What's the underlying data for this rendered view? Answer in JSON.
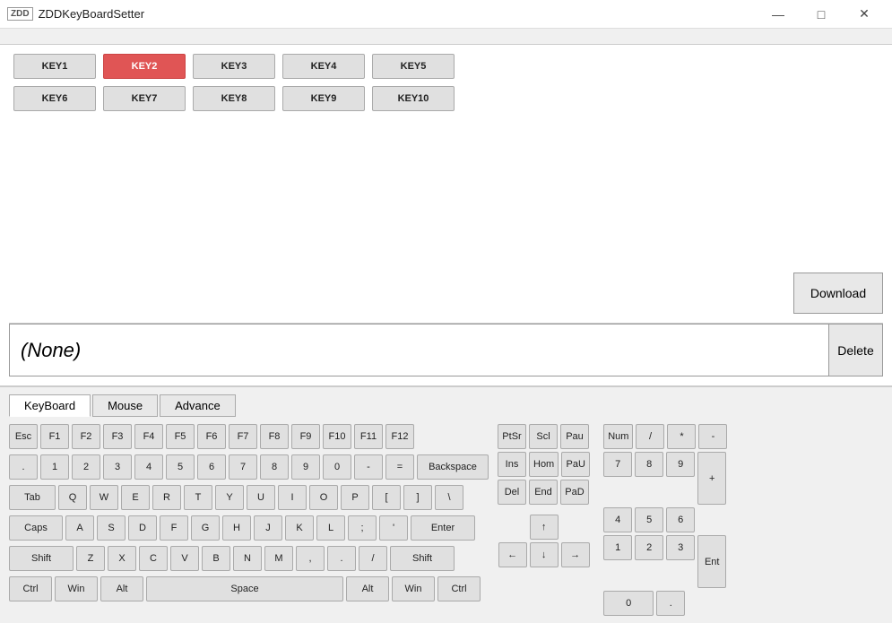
{
  "titleBar": {
    "logo": "ZDD",
    "title": "ZDDKeyBoardSetter",
    "minimizeLabel": "—",
    "maximizeLabel": "□",
    "closeLabel": "✕"
  },
  "keyGrid": {
    "rows": [
      [
        "KEY1",
        "KEY2",
        "KEY3",
        "KEY4",
        "KEY5"
      ],
      [
        "KEY6",
        "KEY7",
        "KEY8",
        "KEY9",
        "KEY10"
      ]
    ],
    "selectedKey": "KEY2"
  },
  "downloadButton": "Download",
  "assignmentArea": {
    "display": "(None)",
    "deleteLabel": "Delete"
  },
  "tabs": [
    "KeyBoard",
    "Mouse",
    "Advance"
  ],
  "activeTab": "KeyBoard",
  "keyboard": {
    "row1": [
      "Esc",
      "F1",
      "F2",
      "F3",
      "F4",
      "F5",
      "F6",
      "F7",
      "F8",
      "F9",
      "F10",
      "F11",
      "F12"
    ],
    "row2": [
      ".",
      "1",
      "2",
      "3",
      "4",
      "5",
      "6",
      "7",
      "8",
      "9",
      "0",
      "-",
      "=",
      "Backspace"
    ],
    "row3": [
      "Tab",
      "Q",
      "W",
      "E",
      "R",
      "T",
      "Y",
      "U",
      "I",
      "O",
      "P",
      "[",
      "]",
      "\\"
    ],
    "row4": [
      "Caps",
      "A",
      "S",
      "D",
      "F",
      "G",
      "H",
      "J",
      "K",
      "L",
      ";",
      "'",
      "Enter"
    ],
    "row5": [
      "Shift",
      "Z",
      "X",
      "C",
      "V",
      "B",
      "N",
      "M",
      ",",
      ".",
      "/",
      "Shift"
    ],
    "row6": [
      "Ctrl",
      "Win",
      "Alt",
      "Space",
      "Alt",
      "Win",
      "Ctrl"
    ],
    "navCluster": {
      "row1": [
        "PtSr",
        "Scl",
        "Pau"
      ],
      "row2": [
        "Ins",
        "Hom",
        "PaU"
      ],
      "row3": [
        "Del",
        "End",
        "PaD"
      ],
      "arrowUp": "↑",
      "arrowLeft": "←",
      "arrowDown": "↓",
      "arrowRight": "→"
    },
    "numpad": {
      "row1": [
        "Num",
        "/",
        "*",
        "-"
      ],
      "row2": [
        "7",
        "8",
        "9",
        "+"
      ],
      "row3": [
        "4",
        "5",
        "6"
      ],
      "row4": [
        "1",
        "2",
        "3",
        "Ent"
      ],
      "row5": [
        "0",
        "."
      ]
    }
  }
}
